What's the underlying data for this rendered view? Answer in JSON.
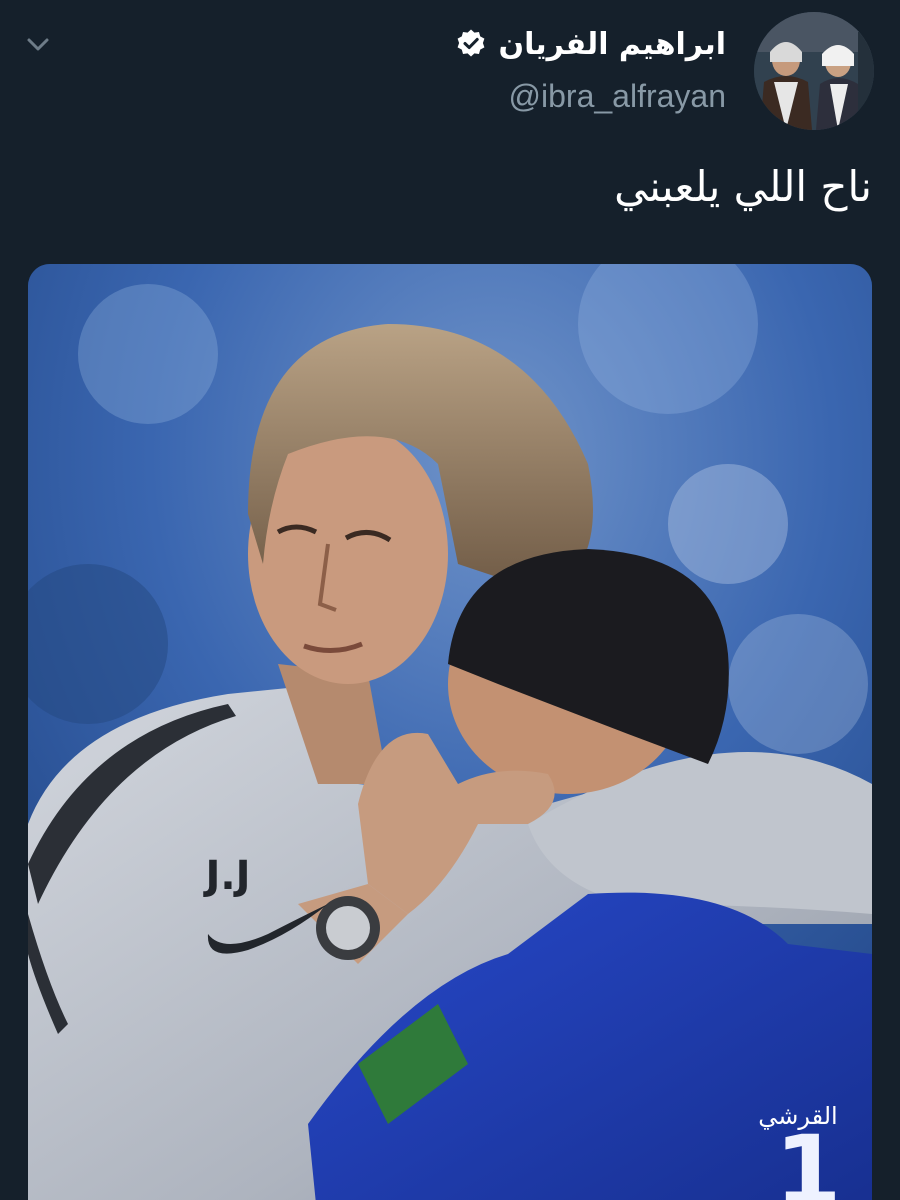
{
  "header": {
    "display_name": "ابراهيم الفريان",
    "handle": "@ibra_alfrayan",
    "verified": true,
    "menu_icon": "chevron-down-icon",
    "avatar_icon": "profile-photo"
  },
  "tweet": {
    "text": "ناح اللي يلعبني"
  },
  "media": {
    "jacket_initials": "J.J",
    "jersey_name": "القرشي",
    "jersey_number": "1",
    "colors": {
      "background": "#15202b",
      "jersey_blue": "#1f3fb5",
      "jacket_grey": "#b6bcc6",
      "stadium_blue": "#3a66b0"
    }
  }
}
